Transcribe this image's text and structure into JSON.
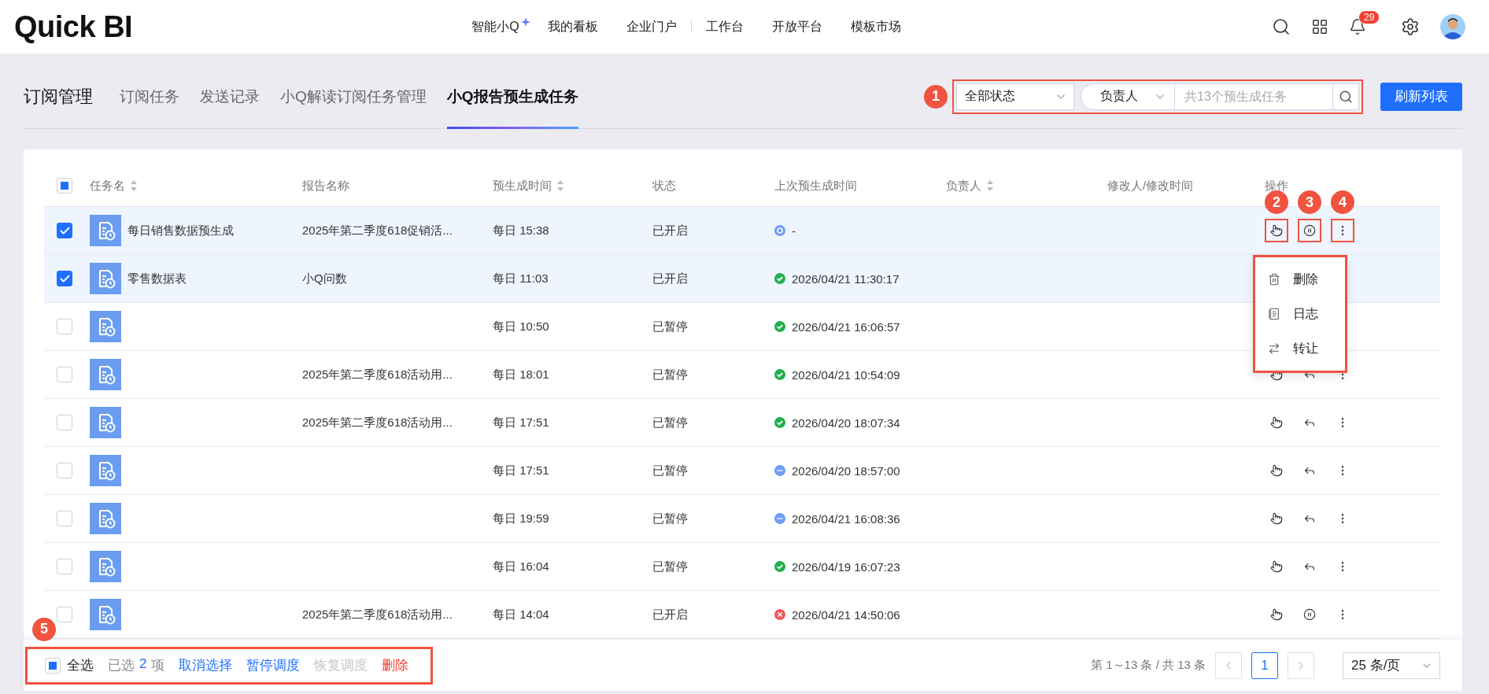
{
  "topbar": {
    "logo": "Quick BI",
    "nav_groups": [
      [
        {
          "label": "智能小Q",
          "kind": "ai"
        },
        {
          "label": "我的看板",
          "kind": "plain"
        },
        {
          "label": "企业门户",
          "kind": "plain"
        }
      ],
      [
        {
          "label": "工作台",
          "kind": "plain"
        },
        {
          "label": "开放平台",
          "kind": "plain"
        },
        {
          "label": "模板市场",
          "kind": "plain"
        }
      ]
    ],
    "notification_count": "29"
  },
  "page_title": "订阅管理",
  "tabs": [
    {
      "label": "订阅任务",
      "selected": false
    },
    {
      "label": "发送记录",
      "selected": false
    },
    {
      "label": "小Q解读订阅任务管理",
      "selected": false
    },
    {
      "label": "小Q报告预生成任务",
      "selected": true
    }
  ],
  "filters": {
    "marker": "1",
    "highlighted": true,
    "status": "全部状态",
    "owner": "负责人",
    "placeholder": "共13个预生成任务"
  },
  "refresh_button": "刷新列表",
  "table": {
    "header_checkbox": {
      "indeterminate": true
    },
    "columns": [
      {
        "label": "任务名",
        "sortable": true
      },
      {
        "label": "报告名称",
        "sortable": false
      },
      {
        "label": "预生成时间",
        "sortable": true
      },
      {
        "label": "状态",
        "sortable": false
      },
      {
        "label": "上次预生成时间",
        "sortable": false
      },
      {
        "label": "负责人",
        "sortable": true
      },
      {
        "label": "修改人/修改时间",
        "sortable": false
      },
      {
        "label": "操作",
        "sortable": false
      }
    ],
    "rows": [
      {
        "selected": true,
        "name": "每日销售数据预生成",
        "report": "2025年第二季度618促销活...",
        "schedule": "每日 15:38",
        "status": "已开启",
        "last_run": {
          "kind": "running",
          "time": "-"
        },
        "actions": [
          {
            "kind": "touch",
            "marker": "2",
            "highlighted": true
          },
          {
            "kind": "pause",
            "marker": "3",
            "highlighted": true
          },
          {
            "kind": "more",
            "marker": "4",
            "highlighted": true,
            "menu": {
              "highlighted": true,
              "items": [
                {
                  "kind": "delete",
                  "label": "删除"
                },
                {
                  "kind": "log",
                  "label": "日志"
                },
                {
                  "kind": "transfer",
                  "label": "转让"
                }
              ]
            }
          }
        ]
      },
      {
        "selected": true,
        "name": "零售数据表",
        "report": "小Q问数",
        "schedule": "每日 11:03",
        "status": "已开启",
        "last_run": {
          "kind": "success",
          "time": "2026/04/21 11:30:17"
        }
      },
      {
        "selected": false,
        "schedule": "每日 10:50",
        "status": "已暂停",
        "last_run": {
          "kind": "success",
          "time": "2026/04/21 16:06:57"
        }
      },
      {
        "selected": false,
        "report": "2025年第二季度618活动用...",
        "schedule": "每日 18:01",
        "status": "已暂停",
        "last_run": {
          "kind": "success",
          "time": "2026/04/21 10:54:09"
        },
        "actions": [
          {
            "kind": "touch",
            "highlighted": false
          },
          {
            "kind": "revert",
            "highlighted": false
          },
          {
            "kind": "more",
            "highlighted": false
          }
        ]
      },
      {
        "selected": false,
        "report": "2025年第二季度618活动用...",
        "schedule": "每日 17:51",
        "status": "已暂停",
        "last_run": {
          "kind": "success",
          "time": "2026/04/20 18:07:34"
        },
        "actions": [
          {
            "kind": "touch",
            "highlighted": false
          },
          {
            "kind": "revert",
            "highlighted": false
          },
          {
            "kind": "more",
            "highlighted": false
          }
        ]
      },
      {
        "selected": false,
        "schedule": "每日 17:51",
        "status": "已暂停",
        "last_run": {
          "kind": "pending",
          "time": "2026/04/20 18:57:00"
        },
        "actions": [
          {
            "kind": "touch",
            "highlighted": false
          },
          {
            "kind": "revert",
            "highlighted": false
          },
          {
            "kind": "more",
            "highlighted": false
          }
        ]
      },
      {
        "selected": false,
        "schedule": "每日 19:59",
        "status": "已暂停",
        "last_run": {
          "kind": "pending",
          "time": "2026/04/21 16:08:36"
        },
        "actions": [
          {
            "kind": "touch",
            "highlighted": false
          },
          {
            "kind": "revert",
            "highlighted": false
          },
          {
            "kind": "more",
            "highlighted": false
          }
        ]
      },
      {
        "selected": false,
        "schedule": "每日 16:04",
        "status": "已暂停",
        "last_run": {
          "kind": "success",
          "time": "2026/04/19 16:07:23"
        },
        "actions": [
          {
            "kind": "touch",
            "highlighted": false
          },
          {
            "kind": "revert",
            "highlighted": false
          },
          {
            "kind": "more",
            "highlighted": false
          }
        ]
      },
      {
        "selected": false,
        "report": "2025年第二季度618活动用...",
        "schedule": "每日 14:04",
        "status": "已开启",
        "last_run": {
          "kind": "error",
          "time": "2026/04/21 14:50:06"
        },
        "actions": [
          {
            "kind": "touch",
            "highlighted": false
          },
          {
            "kind": "pause",
            "highlighted": false
          },
          {
            "kind": "more",
            "highlighted": false
          }
        ]
      }
    ]
  },
  "bulk_bar": {
    "marker": "5",
    "highlighted": true,
    "select_all": {
      "label": "全选",
      "indeterminate": true
    },
    "selected_prefix": "已选",
    "selected_count": "2",
    "selected_suffix": "项",
    "actions": [
      {
        "label": "取消选择",
        "kind": "link",
        "disabled": false
      },
      {
        "label": "暂停调度",
        "kind": "link",
        "disabled": false
      },
      {
        "label": "恢复调度",
        "kind": "link",
        "disabled": true
      },
      {
        "label": "删除",
        "kind": "danger",
        "disabled": false
      }
    ]
  },
  "pagination": {
    "summary": "第 1～13 条 / 共 13 条",
    "prev_disabled": true,
    "next_disabled": true,
    "pages": [
      {
        "label": "1",
        "selected": true
      }
    ],
    "page_size": "25 条/页"
  }
}
